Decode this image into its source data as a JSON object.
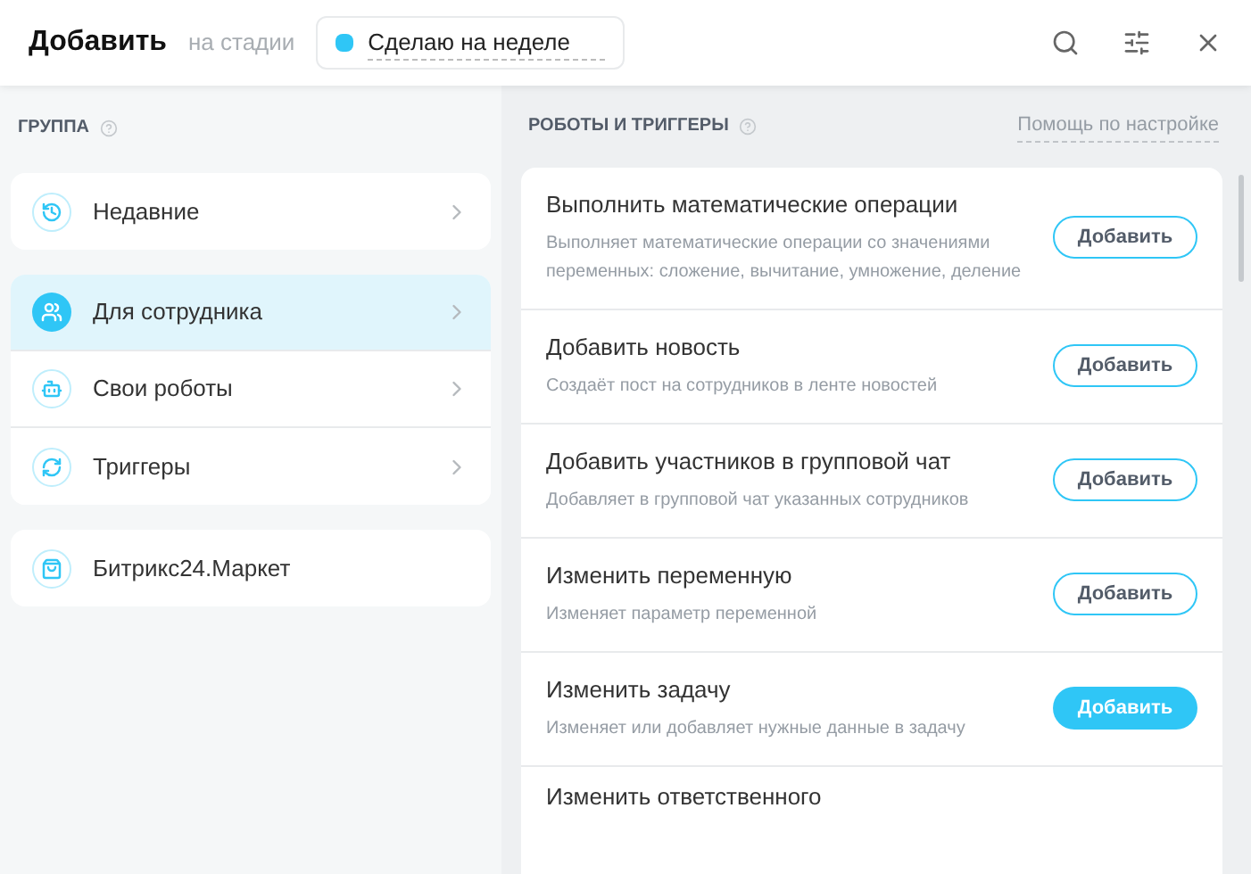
{
  "header": {
    "title": "Добавить",
    "stage_label": "на стадии",
    "stage": {
      "name": "Сделаю на неделе",
      "color": "#2fc6f6"
    }
  },
  "sidebar": {
    "heading": "ГРУППА",
    "groups": [
      {
        "items": [
          {
            "label": "Недавние",
            "kind": "history",
            "selected": false
          }
        ]
      },
      {
        "items": [
          {
            "label": "Для сотрудника",
            "kind": "people",
            "selected": true
          },
          {
            "label": "Свои роботы",
            "kind": "robot",
            "selected": false
          },
          {
            "label": "Триггеры",
            "kind": "cycle",
            "selected": false
          }
        ]
      },
      {
        "items": [
          {
            "label": "Битрикс24.Маркет",
            "kind": "bag",
            "selected": false,
            "arrow": false
          }
        ]
      }
    ]
  },
  "main": {
    "heading": "РОБОТЫ И ТРИГГЕРЫ",
    "help_link": "Помощь по настройке",
    "robots": [
      {
        "title": "Выполнить математические операции",
        "description": "Выполняет математические операции со значениями переменных: сложение, вычитание, умножение, деление",
        "button": "Добавить",
        "highlighted": false
      },
      {
        "title": "Добавить новость",
        "description": "Создаёт пост на сотрудников в ленте новостей",
        "button": "Добавить",
        "highlighted": false
      },
      {
        "title": "Добавить участников в групповой чат",
        "description": "Добавляет в групповой чат указанных сотрудников",
        "button": "Добавить",
        "highlighted": false
      },
      {
        "title": "Изменить переменную",
        "description": "Изменяет параметр переменной",
        "button": "Добавить",
        "highlighted": false
      },
      {
        "title": "Изменить задачу",
        "description": "Изменяет или добавляет нужные данные в задачу",
        "button": "Добавить",
        "highlighted": true
      },
      {
        "title": "Изменить ответственного"
      }
    ]
  }
}
